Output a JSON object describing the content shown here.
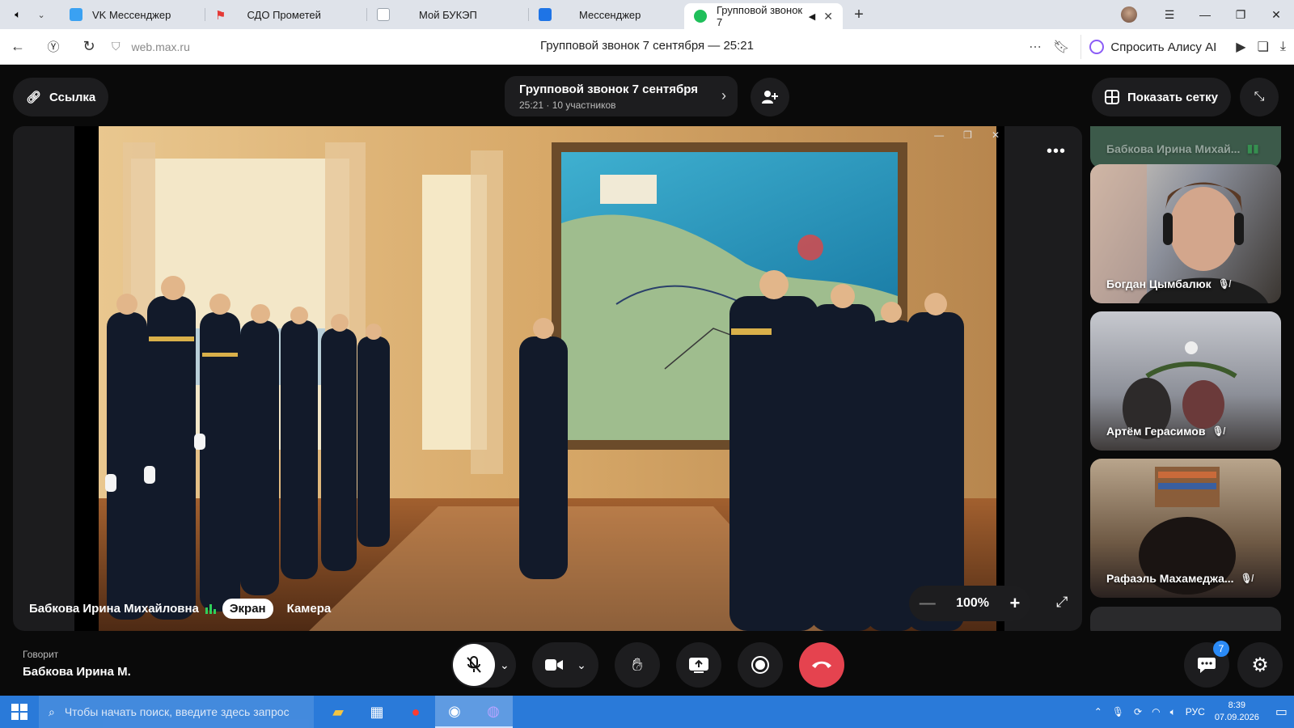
{
  "browser": {
    "tabs": [
      {
        "label": "VK Мессенджер",
        "icon": "vk-icon",
        "color": "#3aa1f2"
      },
      {
        "label": "СДО Прометей",
        "icon": "flag-icon",
        "color": "#e53935"
      },
      {
        "label": "Мой БУКЭП",
        "icon": "document-icon",
        "color": "#9aa3ad"
      },
      {
        "label": "Мессенджер",
        "icon": "messenger-icon",
        "color": "#1e74e6"
      },
      {
        "label": "Групповой звонок 7",
        "icon": "phone-icon",
        "color": "#1fbf5a",
        "active": true
      }
    ],
    "url": "web.max.ru",
    "page_title": "Групповой звонок 7 сентября — 25:21",
    "alice_label": "Спросить Алису AI"
  },
  "call": {
    "link_label": "Ссылка",
    "title": "Групповой звонок 7 сентября",
    "subtitle": "25:21 · 10 участников",
    "grid_label": "Показать сетку",
    "zoom": "100%",
    "sharer": "Бабкова Ирина Михайловна",
    "source_screen": "Экран",
    "source_camera": "Камера",
    "speaking_label": "Говорит",
    "speaking_name": "Бабкова Ирина М.",
    "chat_badge": "7",
    "accent": "#e5434f"
  },
  "participants": [
    {
      "name": "Бабкова Ирина Михай..."
    },
    {
      "name": "Богдан Цымбалюк"
    },
    {
      "name": "Артём Герасимов"
    },
    {
      "name": "Рафаэль Махамеджа..."
    }
  ],
  "taskbar": {
    "search_placeholder": "Чтобы начать поиск, введите здесь запрос",
    "lang": "РУС",
    "time": "8:39",
    "date": "07.09.2026"
  }
}
